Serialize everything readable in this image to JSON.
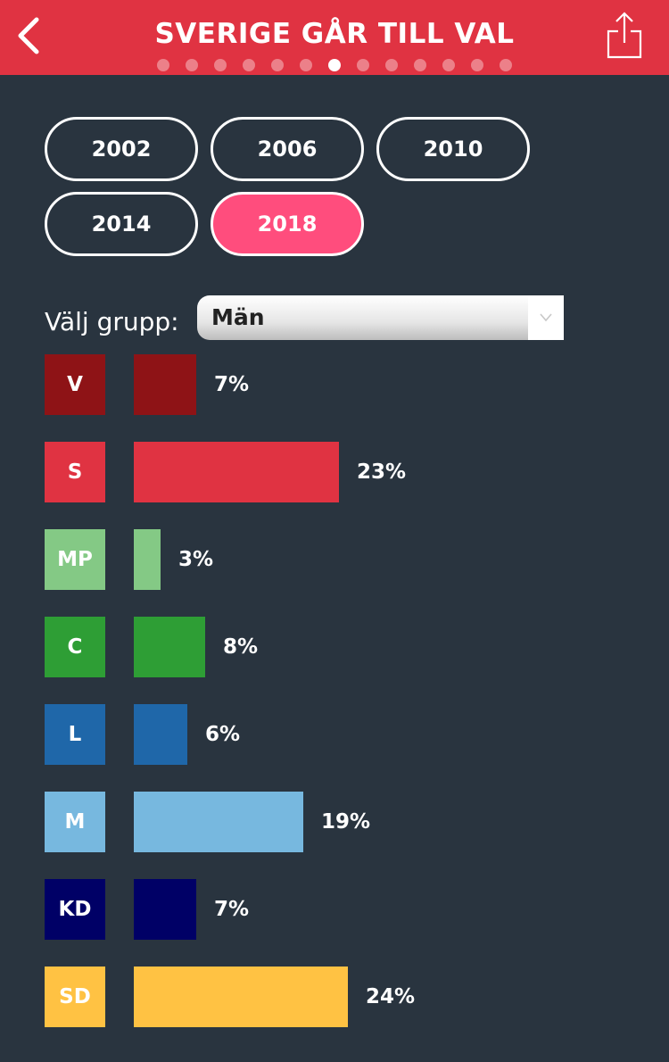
{
  "header": {
    "title": "SVERIGE GÅR TILL VAL",
    "page_count": 13,
    "active_page": 7
  },
  "years": [
    {
      "label": "2002",
      "selected": false
    },
    {
      "label": "2006",
      "selected": false
    },
    {
      "label": "2010",
      "selected": false
    },
    {
      "label": "2014",
      "selected": false
    },
    {
      "label": "2018",
      "selected": true
    }
  ],
  "group": {
    "label": "Välj grupp:",
    "selected": "Män"
  },
  "colors": {
    "background": "#29343f",
    "header": "#e03342",
    "selected_year": "#ff4d7d"
  },
  "chart_data": {
    "type": "bar",
    "categories": [
      "V",
      "S",
      "MP",
      "C",
      "L",
      "M",
      "KD",
      "SD"
    ],
    "values": [
      7,
      23,
      3,
      8,
      6,
      19,
      7,
      24
    ],
    "labels": [
      "7%",
      "23%",
      "3%",
      "8%",
      "6%",
      "19%",
      "7%",
      "24%"
    ],
    "colors": [
      "#8e1316",
      "#e03342",
      "#84c985",
      "#2e9e35",
      "#1f67a9",
      "#77b8df",
      "#000066",
      "#ffc243"
    ],
    "unit": "%"
  }
}
